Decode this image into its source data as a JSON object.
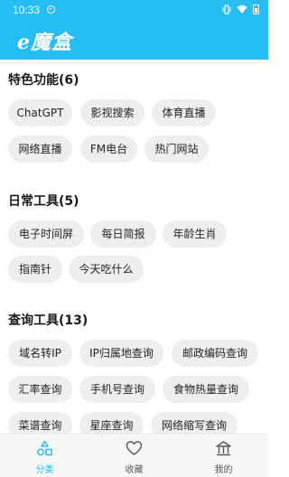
{
  "status_bar": {
    "time": "10:33"
  },
  "app_bar": {
    "title": "e魔盒"
  },
  "sections": [
    {
      "title": "特色功能(6)",
      "items": [
        "ChatGPT",
        "影视搜索",
        "体育直播",
        "网络直播",
        "FM电台",
        "热门网站"
      ]
    },
    {
      "title": "日常工具(5)",
      "items": [
        "电子时间屏",
        "每日简报",
        "年龄生肖",
        "指南针",
        "今天吃什么"
      ]
    },
    {
      "title": "查询工具(13)",
      "items": [
        "域名转IP",
        "IP归属地查询",
        "邮政编码查询",
        "汇率查询",
        "手机号查询",
        "食物热量查询",
        "菜谱查询",
        "星座查询",
        "网络缩写查询"
      ]
    }
  ],
  "bottom_nav": {
    "items": [
      {
        "label": "分类",
        "icon": "category-icon",
        "active": true
      },
      {
        "label": "收藏",
        "icon": "heart-icon",
        "active": false
      },
      {
        "label": "我的",
        "icon": "profile-icon",
        "active": false
      }
    ]
  },
  "colors": {
    "primary": "#25bdf2",
    "chip_bg": "#eeeeee"
  }
}
